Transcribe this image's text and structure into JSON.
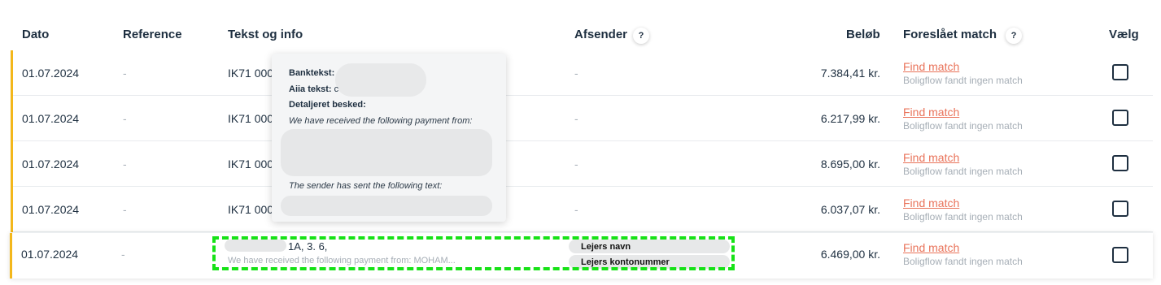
{
  "header": {
    "dato": "Dato",
    "reference": "Reference",
    "tekst": "Tekst og info",
    "afsender": "Afsender",
    "belob": "Beløb",
    "foreslaet": "Foreslået match",
    "vaelg": "Vælg",
    "help_glyph": "?"
  },
  "rows": [
    {
      "date": "01.07.2024",
      "reference": "-",
      "text": "IK71 000",
      "sender": "-",
      "amount": "7.384,41 kr.",
      "match_link": "Find match",
      "match_status": "Boligflow fandt ingen match"
    },
    {
      "date": "01.07.2024",
      "reference": "-",
      "text": "IK71 000",
      "sender": "-",
      "amount": "6.217,99 kr.",
      "match_link": "Find match",
      "match_status": "Boligflow fandt ingen match"
    },
    {
      "date": "01.07.2024",
      "reference": "-",
      "text": "IK71 000",
      "sender": "-",
      "amount": "8.695,00 kr.",
      "match_link": "Find match",
      "match_status": "Boligflow fandt ingen match"
    },
    {
      "date": "01.07.2024",
      "reference": "-",
      "text": "IK71 000",
      "sender": "-",
      "amount": "6.037,07 kr.",
      "match_link": "Find match",
      "match_status": "Boligflow fandt ingen match"
    },
    {
      "date": "01.07.2024",
      "reference": "-",
      "text": "1A, 3. 6,",
      "text_sub": "We have received the following payment from: MOHAM...",
      "sender_name_label": "Lejers navn",
      "sender_account_label": "Lejers kontonummer",
      "amount": "6.469,00 kr.",
      "match_link": "Find match",
      "match_status": "Boligflow fandt ingen match"
    }
  ],
  "popup": {
    "banktekst_label": "Banktekst",
    "aiia_label": "Aiia tekst",
    "aiia_value_fragment": "c",
    "detaljeret_label": "Detaljeret besked",
    "colon": ":",
    "received_text": "We have received the following payment from:",
    "sender_text": "The sender has sent the following text:"
  },
  "colors": {
    "accent_bar": "#f3b71b",
    "link": "#e9735a",
    "highlight": "#17e217"
  }
}
